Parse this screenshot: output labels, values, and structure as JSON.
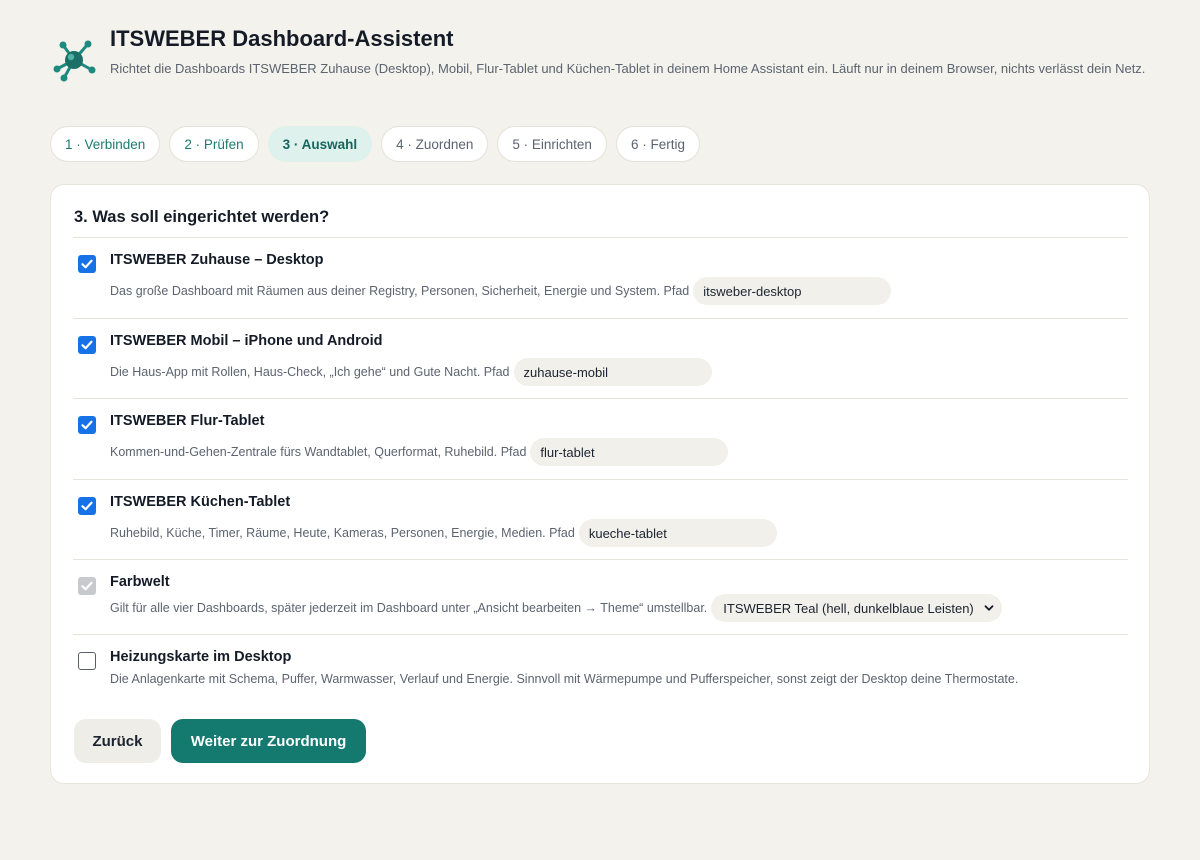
{
  "app": {
    "title": "ITSWEBER Dashboard-Assistent",
    "subtitle": "Richtet die Dashboards ITSWEBER Zuhause (Desktop), Mobil, Flur-Tablet und Küchen-Tablet in deinem Home Assistant ein. Läuft nur in deinem Browser, nichts verlässt dein Netz.",
    "logo_icon": "molecule-logo-icon",
    "accent_color": "#147a70"
  },
  "steps": [
    {
      "label": "1 · Verbinden",
      "state": "done"
    },
    {
      "label": "2 · Prüfen",
      "state": "done"
    },
    {
      "label": "3 · Auswahl",
      "state": "active"
    },
    {
      "label": "4 · Zuordnen",
      "state": "upcoming"
    },
    {
      "label": "5 · Einrichten",
      "state": "upcoming"
    },
    {
      "label": "6 · Fertig",
      "state": "upcoming"
    }
  ],
  "card": {
    "title": "3. Was soll eingerichtet werden?",
    "options": [
      {
        "title": "ITSWEBER Zuhause – Desktop",
        "description": "Das große Dashboard mit Räumen aus deiner Registry, Personen, Sicherheit, Energie und System. Pfad",
        "path": "itsweber-desktop",
        "checked": true
      },
      {
        "title": "ITSWEBER Mobil – iPhone und Android",
        "description": "Die Haus-App mit Rollen, Haus-Check, „Ich gehe“ und Gute Nacht. Pfad",
        "path": "zuhause-mobil",
        "checked": true
      },
      {
        "title": "ITSWEBER Flur-Tablet",
        "description": "Kommen-und-Gehen-Zentrale fürs Wandtablet, Querformat, Ruhebild. Pfad",
        "path": "flur-tablet",
        "checked": true
      },
      {
        "title": "ITSWEBER Küchen-Tablet",
        "description": "Ruhebild, Küche, Timer, Räume, Heute, Kameras, Personen, Energie, Medien. Pfad",
        "path": "kueche-tablet",
        "checked": true
      },
      {
        "title": "Farbwelt",
        "description": "Gilt für alle vier Dashboards, später jederzeit im Dashboard unter „Ansicht bearbeiten → Theme“ umstellbar.",
        "theme_value": "ITSWEBER Teal (hell, dunkelblaue Leisten)",
        "checked": true,
        "disabled": true
      },
      {
        "title": "Heizungskarte im Desktop",
        "description": "Die Anlagenkarte mit Schema, Puffer, Warmwasser, Verlauf und Energie. Sinnvoll mit Wärmepumpe und Pufferspeicher, sonst zeigt der Desktop deine Thermostate.",
        "checked": false
      }
    ]
  },
  "buttons": {
    "back": "Zurück",
    "next": "Weiter zur Zuordnung"
  }
}
